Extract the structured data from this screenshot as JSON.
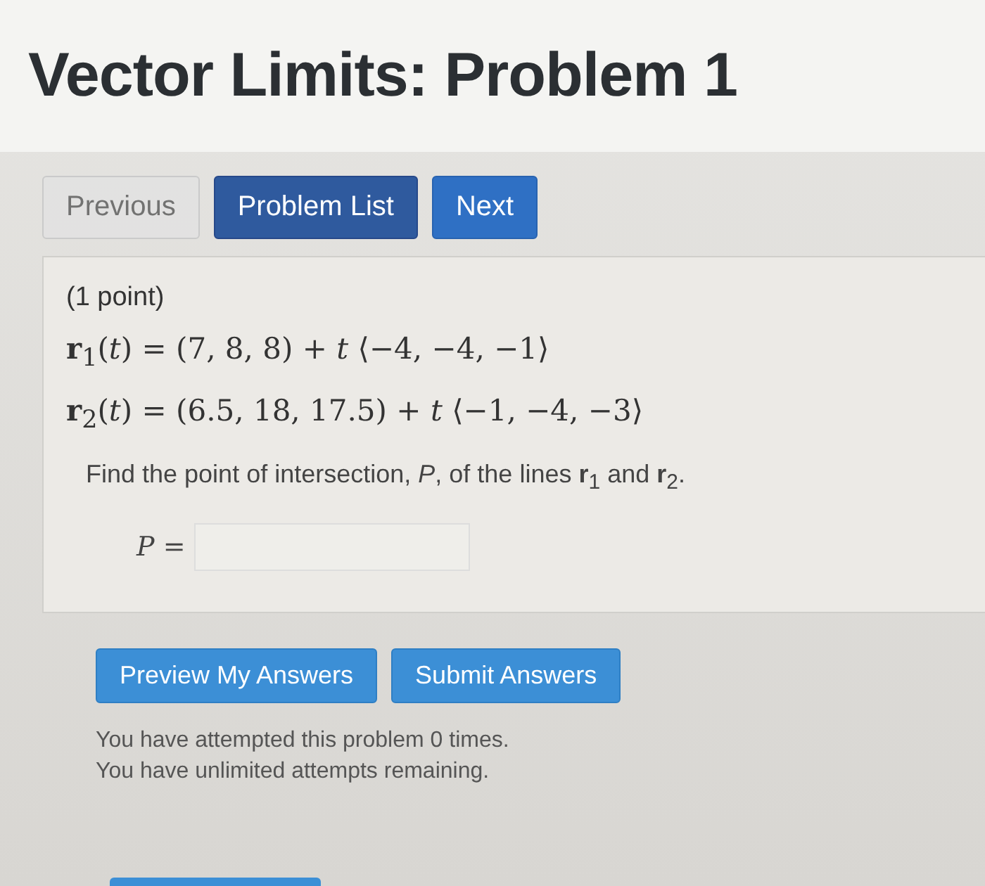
{
  "title": "Vector Limits: Problem 1",
  "nav_buttons": [
    {
      "label": "Previous",
      "kind": "default",
      "disabled": true
    },
    {
      "label": "Problem List",
      "kind": "dark",
      "disabled": false
    },
    {
      "label": "Next",
      "kind": "primary",
      "disabled": false
    }
  ],
  "problem": {
    "points": "(1 point)",
    "equations": [
      "**r**$_{1}$(*t*) = (7, 8, 8) + *t* ⟨−4, −4, −1⟩",
      "**r**$_{2}$(*t*) = (6.5, 18, 17.5) + *t* ⟨−1, −4, −3⟩"
    ],
    "prompt": "Find the point of intersection, *P*, of the lines **r**$_{1}$ and **r**$_{2}$.",
    "answer_label": "*P* ="
  },
  "action_buttons": [
    "Preview My Answers",
    "Submit Answers"
  ],
  "messages": [
    "You have attempted this problem 0 times.",
    "You have unlimited attempts remaining."
  ]
}
